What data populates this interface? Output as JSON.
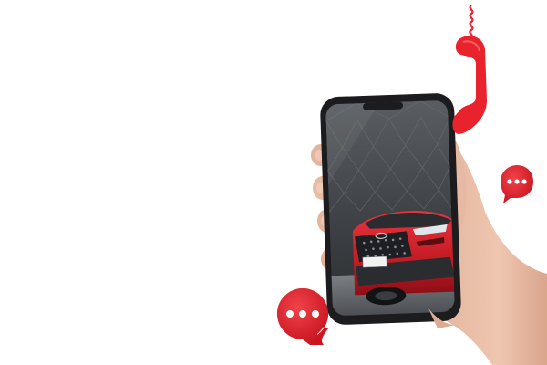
{
  "scene": {
    "subject": "hand-holding-smartphone-with-car-photo",
    "background_color": "#ffffff"
  },
  "phone": {
    "screen_content": "red-suv-front-view",
    "frame_color": "#1c1c1e"
  },
  "car": {
    "body_color": "#d0202b",
    "plate_text": ""
  },
  "decorations": {
    "telephone_handset_icon": "red-telephone-handset-icon",
    "chat_bubble_icons": [
      "chat-bubble-icon",
      "chat-bubble-icon"
    ],
    "accent_color": "#e8232d"
  }
}
